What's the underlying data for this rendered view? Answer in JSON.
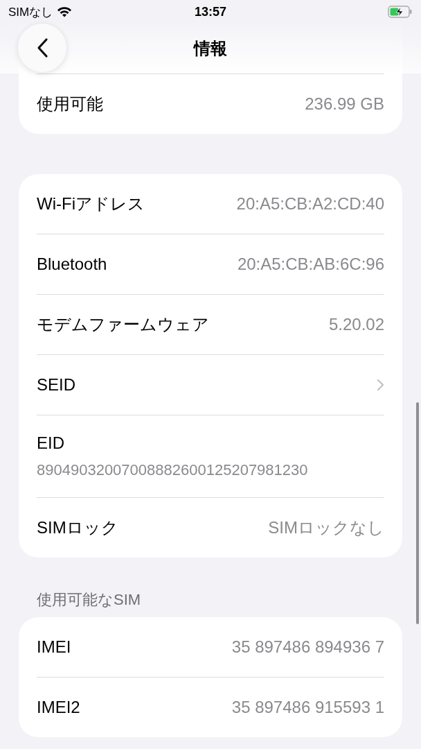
{
  "status_bar": {
    "carrier": "SIMなし",
    "time": "13:57"
  },
  "nav": {
    "title": "情報"
  },
  "storage": {
    "rows": [
      {
        "label": "使用可能",
        "value": "236.99 GB"
      }
    ]
  },
  "network": {
    "rows": [
      {
        "kind": "value",
        "label": "Wi-Fiアドレス",
        "value": "20:A5:CB:A2:CD:40"
      },
      {
        "kind": "value",
        "label": "Bluetooth",
        "value": "20:A5:CB:AB:6C:96"
      },
      {
        "kind": "value",
        "label": "モデムファームウェア",
        "value": "5.20.02"
      },
      {
        "kind": "link",
        "label": "SEID"
      },
      {
        "kind": "stacked",
        "label": "EID",
        "value": "89049032007008882600125207981230"
      },
      {
        "kind": "value",
        "label": "SIMロック",
        "value": "SIMロックなし"
      }
    ]
  },
  "sim_section": {
    "header": "使用可能なSIM",
    "rows": [
      {
        "kind": "value",
        "label": "IMEI",
        "value": "35 897486 894936 7"
      },
      {
        "kind": "value",
        "label": "IMEI2",
        "value": "35 897486 915593 1"
      }
    ]
  }
}
